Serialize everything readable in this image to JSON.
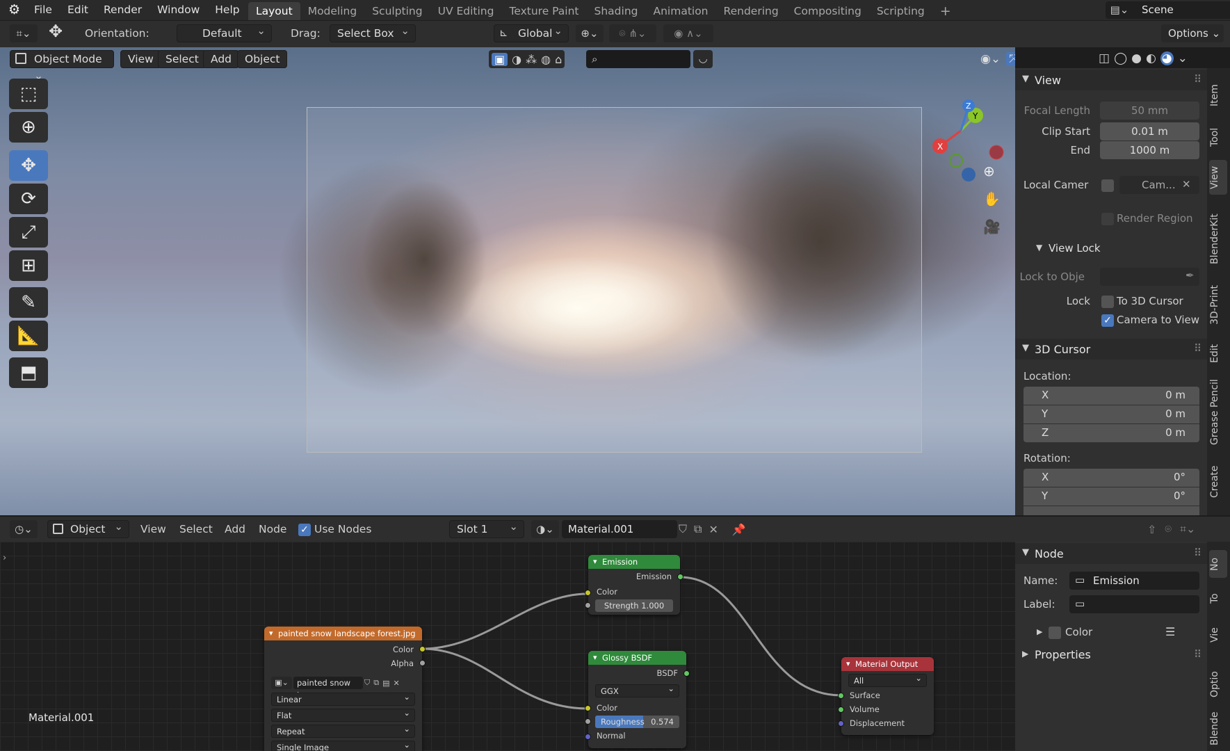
{
  "menu": [
    "File",
    "Edit",
    "Render",
    "Window",
    "Help"
  ],
  "workspaces": [
    "Layout",
    "Modeling",
    "Sculpting",
    "UV Editing",
    "Texture Paint",
    "Shading",
    "Animation",
    "Rendering",
    "Compositing",
    "Scripting"
  ],
  "active_workspace": "Layout",
  "scene_name": "Scene",
  "toolheader": {
    "orientation_label": "Orientation:",
    "orientation_value": "Default",
    "drag_label": "Drag:",
    "drag_value": "Select Box",
    "transform_orientation": "Global",
    "options_label": "Options"
  },
  "viewport_header": {
    "mode": "Object Mode",
    "menus": [
      "View",
      "Select",
      "Add",
      "Object"
    ]
  },
  "gizmo": {
    "x": "X",
    "y": "Y",
    "z": "Z"
  },
  "npanel": {
    "view_title": "View",
    "focal_length_label": "Focal Length",
    "focal_length_value": "50 mm",
    "clip_start_label": "Clip Start",
    "clip_start_value": "0.01 m",
    "clip_end_label": "End",
    "clip_end_value": "1000 m",
    "local_camera_label": "Local Camer",
    "local_camera_value": "Cam...",
    "render_region_label": "Render Region",
    "view_lock_title": "View Lock",
    "lock_to_object_label": "Lock to Obje",
    "lock_label": "Lock",
    "to_3d_cursor_label": "To 3D Cursor",
    "camera_to_view_label": "Camera to View",
    "cursor_title": "3D Cursor",
    "location_label": "Location:",
    "location": [
      {
        "axis": "X",
        "value": "0 m"
      },
      {
        "axis": "Y",
        "value": "0 m"
      },
      {
        "axis": "Z",
        "value": "0 m"
      }
    ],
    "rotation_label": "Rotation:",
    "rotation": [
      {
        "axis": "X",
        "value": "0°"
      },
      {
        "axis": "Y",
        "value": "0°"
      }
    ]
  },
  "vtabs": [
    "Item",
    "Tool",
    "View",
    "BlenderKit",
    "3D-Print",
    "Edit",
    "Grease Pencil",
    "Create"
  ],
  "active_vtab": "View",
  "node_header": {
    "object_type": "Object",
    "menus": [
      "View",
      "Select",
      "Add",
      "Node"
    ],
    "use_nodes_label": "Use Nodes",
    "slot": "Slot 1",
    "material": "Material.001"
  },
  "node_area_label": "Material.001",
  "nodes": {
    "image_texture": {
      "title": "painted snow landscape forest.jpg",
      "out_color": "Color",
      "out_alpha": "Alpha",
      "image_name": "painted snow la...",
      "interpolation": "Linear",
      "projection": "Flat",
      "extension": "Repeat",
      "source": "Single Image"
    },
    "emission": {
      "title": "Emission",
      "out": "Emission",
      "in_color": "Color",
      "strength_label": "Strength",
      "strength_value": "1.000"
    },
    "glossy": {
      "title": "Glossy BSDF",
      "out": "BSDF",
      "distribution": "GGX",
      "in_color": "Color",
      "roughness_label": "Roughness",
      "roughness_value": "0.574",
      "normal_label": "Normal"
    },
    "output": {
      "title": "Material Output",
      "target": "All",
      "surface": "Surface",
      "volume": "Volume",
      "displacement": "Displacement"
    }
  },
  "node_side": {
    "node_title": "Node",
    "name_label": "Name:",
    "name_value": "Emission",
    "label_label": "Label:",
    "color_label": "Color",
    "properties_title": "Properties"
  },
  "node_vtabs": [
    "No",
    "To",
    "Vie",
    "Optio",
    "Blende"
  ]
}
